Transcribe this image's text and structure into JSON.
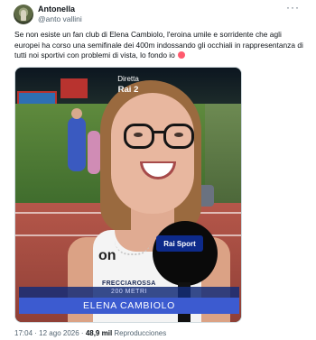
{
  "tweet": {
    "author_name": "Antonella",
    "author_handle": "@anto vallini",
    "more_icon": "more-dots-icon",
    "text": "Se non esiste un fan club di Elena Cambiolo, l'eroina umile e sorridente che agli europei ha corso una semifinale dei 400m indossando gli occhiali in rappresentanza di tutti noi sportivi con problemi di vista, lo fondo io",
    "emoji": "heart-eyes-emoji"
  },
  "media": {
    "live_label": "Diretta",
    "channel": "Rai 2",
    "mic_brand": "Rai Sport",
    "shirt_logo": "on",
    "shirt_sponsor": "FRECCIAROSSA",
    "lower_third_event": "200 METRI",
    "lower_third_name": "ELENA CAMBIOLO"
  },
  "footer": {
    "time": "17:04",
    "separator1": "·",
    "date": "12 ago 2026",
    "separator2": "·",
    "views": "48,9 mil",
    "views_label": "Reproducciones"
  }
}
